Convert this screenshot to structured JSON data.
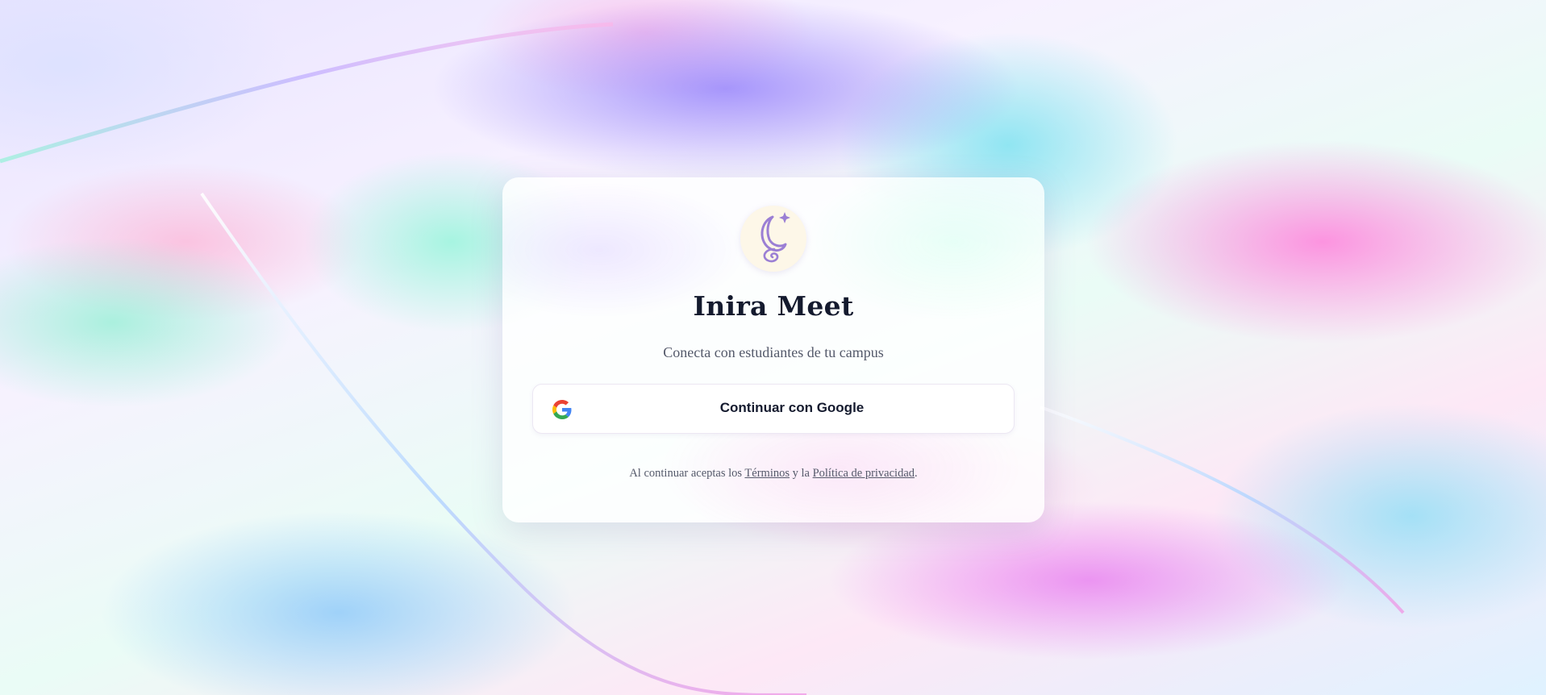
{
  "app": {
    "title": "Inira Meet",
    "tagline": "Conecta con estudiantes de tu campus"
  },
  "auth": {
    "google_button_label": "Continuar con Google",
    "google_icon": "google-g-icon"
  },
  "legal": {
    "prefix": "Al continuar aceptas los",
    "terms_link": "Términos",
    "connector": "y la",
    "privacy_link": "Política de privacidad",
    "suffix": "."
  },
  "logo": {
    "icon": "crescent-moon-sparkle-icon",
    "color": "#9b7fd4",
    "background": "#fdf7e8"
  }
}
